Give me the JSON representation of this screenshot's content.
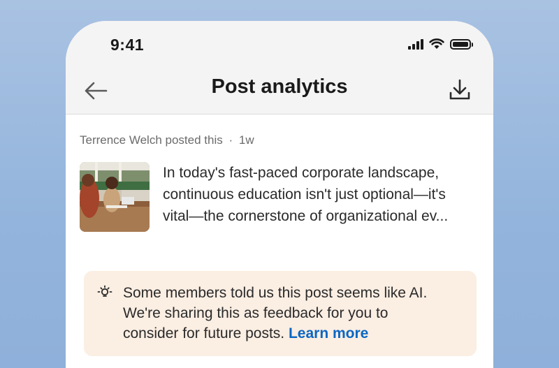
{
  "status_bar": {
    "time": "9:41",
    "icons": [
      "signal-icon",
      "wifi-icon",
      "battery-icon"
    ]
  },
  "header": {
    "title": "Post analytics",
    "back_icon": "arrow-left-icon",
    "download_icon": "download-icon"
  },
  "post": {
    "author_line": "Terrence Welch posted this",
    "separator": "·",
    "age": "1w",
    "text_lines": [
      "In today's fast-paced corporate landscape,",
      "continuous education isn't just optional—it's",
      "vital—the cornerstone of organizational ev..."
    ]
  },
  "ai_notice": {
    "icon": "lightbulb-icon",
    "lines": [
      "Some members told us this post seems like AI.",
      "We're sharing this as feedback for you to",
      "consider for future posts."
    ],
    "link_label": "Learn more"
  },
  "colors": {
    "background_top": "#a9c2e2",
    "background_bottom": "#8fb0da",
    "notice_bg": "#fbeee3",
    "link": "#0a66c2",
    "text": "#2a2a2a",
    "muted": "#6b6b6b"
  }
}
